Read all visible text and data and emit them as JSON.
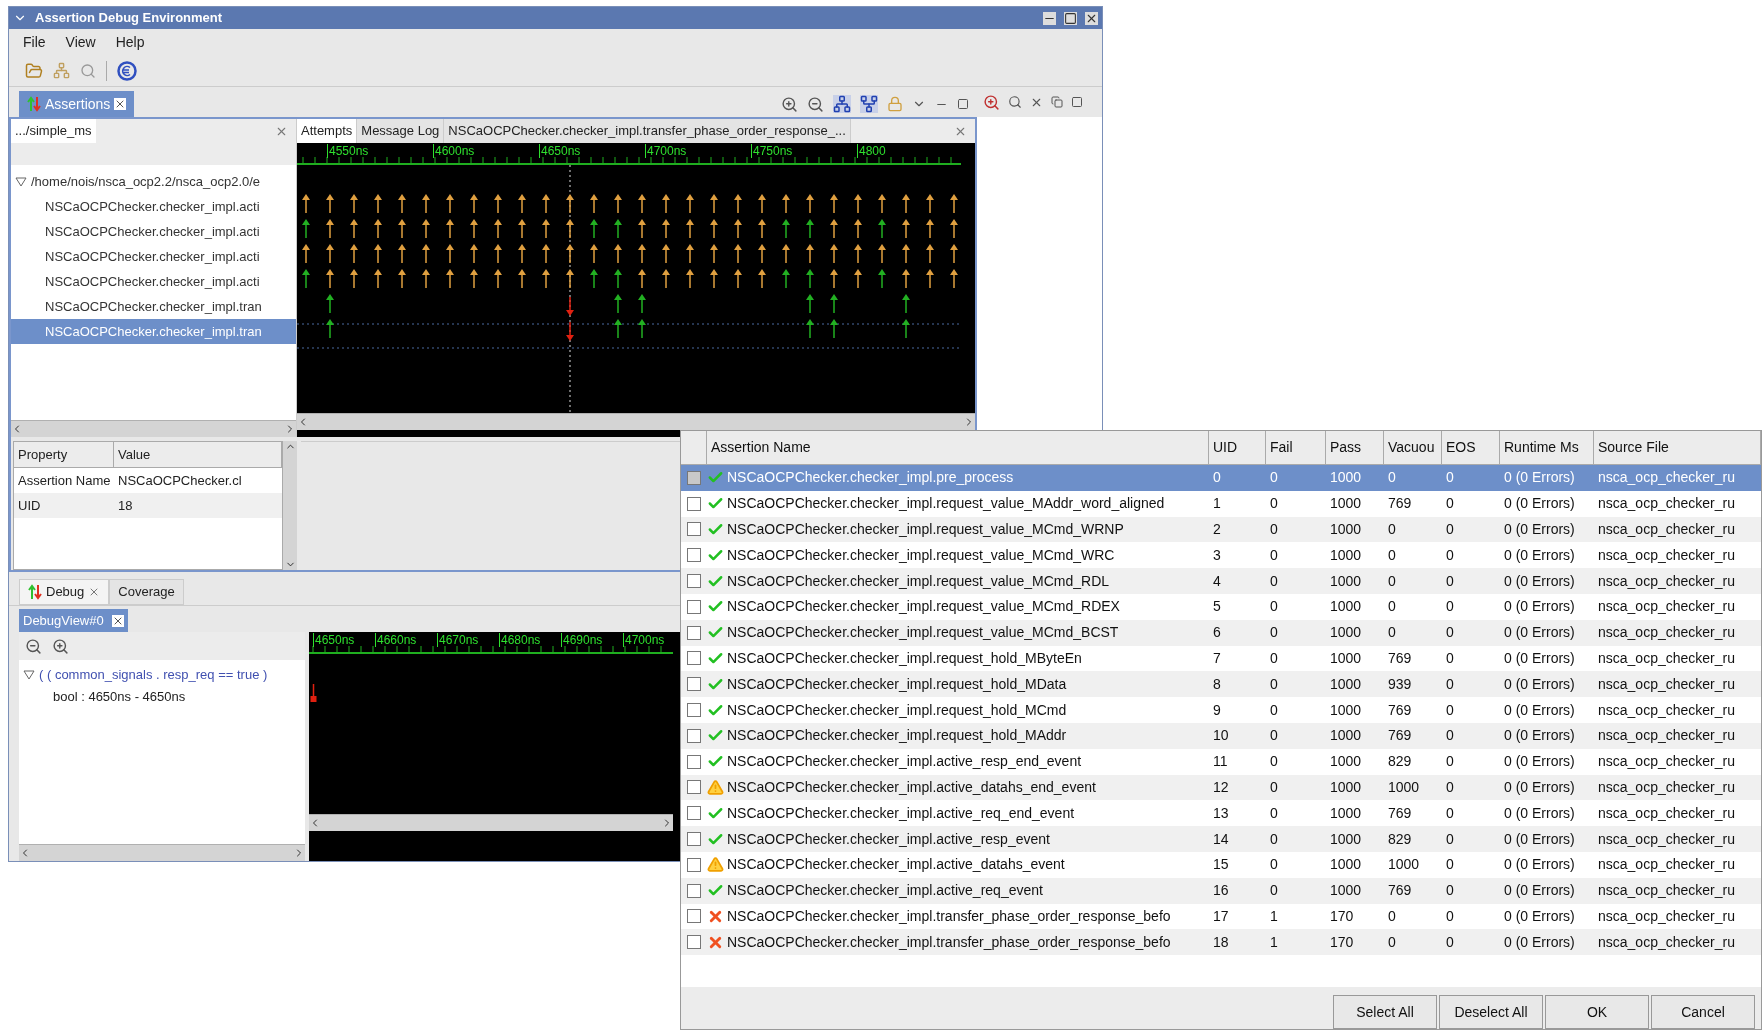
{
  "window": {
    "title": "Assertion Debug Environment",
    "menu": [
      "File",
      "View",
      "Help"
    ]
  },
  "assertions_view": {
    "tab": "Assertions"
  },
  "navigator": {
    "tab": ".../simple_ms",
    "tree": {
      "label": "/home/nois/nsca_ocp2.2/nsca_ocp2.0/e",
      "expanded": true,
      "children": [
        {
          "label": "NSCaOCPChecker.checker_impl.acti",
          "selected": false
        },
        {
          "label": "NSCaOCPChecker.checker_impl.acti",
          "selected": false
        },
        {
          "label": "NSCaOCPChecker.checker_impl.acti",
          "selected": false
        },
        {
          "label": "NSCaOCPChecker.checker_impl.acti",
          "selected": false
        },
        {
          "label": "NSCaOCPChecker.checker_impl.tran",
          "selected": false
        },
        {
          "label": "NSCaOCPChecker.checker_impl.tran",
          "selected": true
        }
      ]
    }
  },
  "attempts": {
    "tabs": [
      {
        "label": "Attempts",
        "selected": true
      },
      {
        "label": "Message Log",
        "selected": false
      },
      {
        "label": "NSCaOCPChecker.checker_impl.transfer_phase_order_response_...",
        "selected": false
      }
    ],
    "ruler": [
      "4550ns",
      "4600ns",
      "4650ns",
      "4700ns",
      "4750ns",
      "4800"
    ]
  },
  "properties": {
    "columns": [
      "Property",
      "Value"
    ],
    "rows": [
      {
        "property": "Assertion Name",
        "value": "NSCaOCPChecker.cl"
      },
      {
        "property": "UID",
        "value": "18"
      }
    ]
  },
  "debug": {
    "tabs": [
      {
        "label": "Debug",
        "selected": true
      },
      {
        "label": "Coverage",
        "selected": false
      }
    ],
    "view_tab": "DebugView#0",
    "tree": {
      "label": "( ( common_signals . resp_req == true )",
      "expanded": true,
      "children": [
        {
          "label": "bool : 4650ns - 4650ns"
        }
      ]
    },
    "ruler": [
      "4650ns",
      "4660ns",
      "4670ns",
      "4680ns",
      "4690ns",
      "4700ns"
    ]
  },
  "dialog": {
    "columns": [
      "Assertion Name",
      "UID",
      "Fail",
      "Pass",
      "Vacuou",
      "EOS",
      "Runtime Ms",
      "Source File"
    ],
    "rows": [
      {
        "checked": false,
        "selected": true,
        "kind": "pass",
        "name": "NSCaOCPChecker.checker_impl.pre_process",
        "uid": "0",
        "fail": "0",
        "pass": "1000",
        "vacuous": "0",
        "eos": "0",
        "runtime": "0 (0 Errors)",
        "source": "nsca_ocp_checker_ru"
      },
      {
        "checked": false,
        "selected": false,
        "kind": "pass",
        "name": "NSCaOCPChecker.checker_impl.request_value_MAddr_word_aligned",
        "uid": "1",
        "fail": "0",
        "pass": "1000",
        "vacuous": "769",
        "eos": "0",
        "runtime": "0 (0 Errors)",
        "source": "nsca_ocp_checker_ru"
      },
      {
        "checked": false,
        "selected": false,
        "kind": "pass",
        "name": "NSCaOCPChecker.checker_impl.request_value_MCmd_WRNP",
        "uid": "2",
        "fail": "0",
        "pass": "1000",
        "vacuous": "0",
        "eos": "0",
        "runtime": "0 (0 Errors)",
        "source": "nsca_ocp_checker_ru"
      },
      {
        "checked": false,
        "selected": false,
        "kind": "pass",
        "name": "NSCaOCPChecker.checker_impl.request_value_MCmd_WRC",
        "uid": "3",
        "fail": "0",
        "pass": "1000",
        "vacuous": "0",
        "eos": "0",
        "runtime": "0 (0 Errors)",
        "source": "nsca_ocp_checker_ru"
      },
      {
        "checked": false,
        "selected": false,
        "kind": "pass",
        "name": "NSCaOCPChecker.checker_impl.request_value_MCmd_RDL",
        "uid": "4",
        "fail": "0",
        "pass": "1000",
        "vacuous": "0",
        "eos": "0",
        "runtime": "0 (0 Errors)",
        "source": "nsca_ocp_checker_ru"
      },
      {
        "checked": false,
        "selected": false,
        "kind": "pass",
        "name": "NSCaOCPChecker.checker_impl.request_value_MCmd_RDEX",
        "uid": "5",
        "fail": "0",
        "pass": "1000",
        "vacuous": "0",
        "eos": "0",
        "runtime": "0 (0 Errors)",
        "source": "nsca_ocp_checker_ru"
      },
      {
        "checked": false,
        "selected": false,
        "kind": "pass",
        "name": "NSCaOCPChecker.checker_impl.request_value_MCmd_BCST",
        "uid": "6",
        "fail": "0",
        "pass": "1000",
        "vacuous": "0",
        "eos": "0",
        "runtime": "0 (0 Errors)",
        "source": "nsca_ocp_checker_ru"
      },
      {
        "checked": false,
        "selected": false,
        "kind": "pass",
        "name": "NSCaOCPChecker.checker_impl.request_hold_MByteEn",
        "uid": "7",
        "fail": "0",
        "pass": "1000",
        "vacuous": "769",
        "eos": "0",
        "runtime": "0 (0 Errors)",
        "source": "nsca_ocp_checker_ru"
      },
      {
        "checked": false,
        "selected": false,
        "kind": "pass",
        "name": "NSCaOCPChecker.checker_impl.request_hold_MData",
        "uid": "8",
        "fail": "0",
        "pass": "1000",
        "vacuous": "939",
        "eos": "0",
        "runtime": "0 (0 Errors)",
        "source": "nsca_ocp_checker_ru"
      },
      {
        "checked": false,
        "selected": false,
        "kind": "pass",
        "name": "NSCaOCPChecker.checker_impl.request_hold_MCmd",
        "uid": "9",
        "fail": "0",
        "pass": "1000",
        "vacuous": "769",
        "eos": "0",
        "runtime": "0 (0 Errors)",
        "source": "nsca_ocp_checker_ru"
      },
      {
        "checked": false,
        "selected": false,
        "kind": "pass",
        "name": "NSCaOCPChecker.checker_impl.request_hold_MAddr",
        "uid": "10",
        "fail": "0",
        "pass": "1000",
        "vacuous": "769",
        "eos": "0",
        "runtime": "0 (0 Errors)",
        "source": "nsca_ocp_checker_ru"
      },
      {
        "checked": false,
        "selected": false,
        "kind": "pass",
        "name": "NSCaOCPChecker.checker_impl.active_resp_end_event",
        "uid": "11",
        "fail": "0",
        "pass": "1000",
        "vacuous": "829",
        "eos": "0",
        "runtime": "0 (0 Errors)",
        "source": "nsca_ocp_checker_ru"
      },
      {
        "checked": false,
        "selected": false,
        "kind": "warning",
        "name": "NSCaOCPChecker.checker_impl.active_datahs_end_event",
        "uid": "12",
        "fail": "0",
        "pass": "1000",
        "vacuous": "1000",
        "eos": "0",
        "runtime": "0 (0 Errors)",
        "source": "nsca_ocp_checker_ru"
      },
      {
        "checked": false,
        "selected": false,
        "kind": "pass",
        "name": "NSCaOCPChecker.checker_impl.active_req_end_event",
        "uid": "13",
        "fail": "0",
        "pass": "1000",
        "vacuous": "769",
        "eos": "0",
        "runtime": "0 (0 Errors)",
        "source": "nsca_ocp_checker_ru"
      },
      {
        "checked": false,
        "selected": false,
        "kind": "pass",
        "name": "NSCaOCPChecker.checker_impl.active_resp_event",
        "uid": "14",
        "fail": "0",
        "pass": "1000",
        "vacuous": "829",
        "eos": "0",
        "runtime": "0 (0 Errors)",
        "source": "nsca_ocp_checker_ru"
      },
      {
        "checked": false,
        "selected": false,
        "kind": "warning",
        "name": "NSCaOCPChecker.checker_impl.active_datahs_event",
        "uid": "15",
        "fail": "0",
        "pass": "1000",
        "vacuous": "1000",
        "eos": "0",
        "runtime": "0 (0 Errors)",
        "source": "nsca_ocp_checker_ru"
      },
      {
        "checked": false,
        "selected": false,
        "kind": "pass",
        "name": "NSCaOCPChecker.checker_impl.active_req_event",
        "uid": "16",
        "fail": "0",
        "pass": "1000",
        "vacuous": "769",
        "eos": "0",
        "runtime": "0 (0 Errors)",
        "source": "nsca_ocp_checker_ru"
      },
      {
        "checked": false,
        "selected": false,
        "kind": "fail",
        "name": "NSCaOCPChecker.checker_impl.transfer_phase_order_response_befo",
        "uid": "17",
        "fail": "1",
        "pass": "170",
        "vacuous": "0",
        "eos": "0",
        "runtime": "0 (0 Errors)",
        "source": "nsca_ocp_checker_ru"
      },
      {
        "checked": false,
        "selected": false,
        "kind": "fail",
        "name": "NSCaOCPChecker.checker_impl.transfer_phase_order_response_befo",
        "uid": "18",
        "fail": "1",
        "pass": "170",
        "vacuous": "0",
        "eos": "0",
        "runtime": "0 (0 Errors)",
        "source": "nsca_ocp_checker_ru"
      }
    ],
    "buttons": [
      "Select All",
      "Deselect All",
      "OK",
      "Cancel"
    ]
  }
}
